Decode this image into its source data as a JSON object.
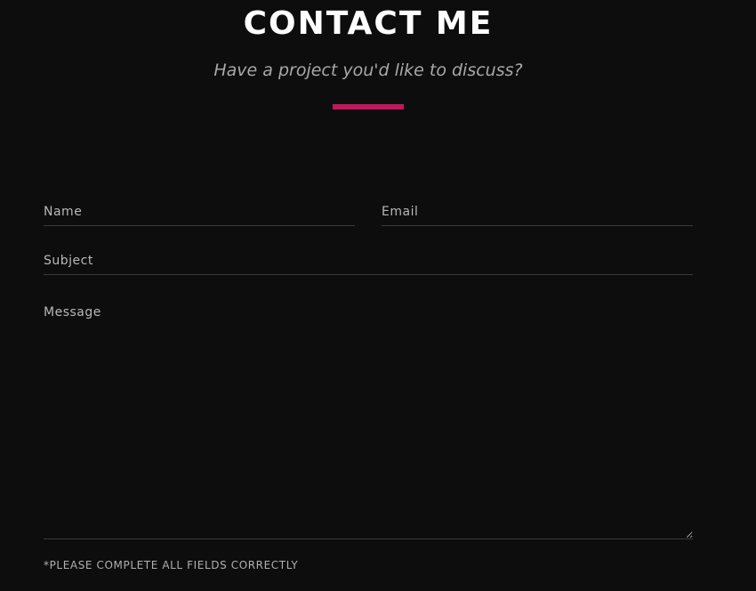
{
  "header": {
    "title": "CONTACT ME",
    "subtitle": "Have a project you'd like to discuss?",
    "accent_color": "#c2185b"
  },
  "form": {
    "name": {
      "placeholder": "Name",
      "value": ""
    },
    "email": {
      "placeholder": "Email",
      "value": ""
    },
    "subject": {
      "placeholder": "Subject",
      "value": ""
    },
    "message": {
      "placeholder": "Message",
      "value": ""
    },
    "note": "*PLEASE COMPLETE ALL FIELDS CORRECTLY"
  },
  "colors": {
    "background": "#0d0d0d",
    "field_border": "#3a3a3a",
    "placeholder_text": "#b8b8b8"
  }
}
